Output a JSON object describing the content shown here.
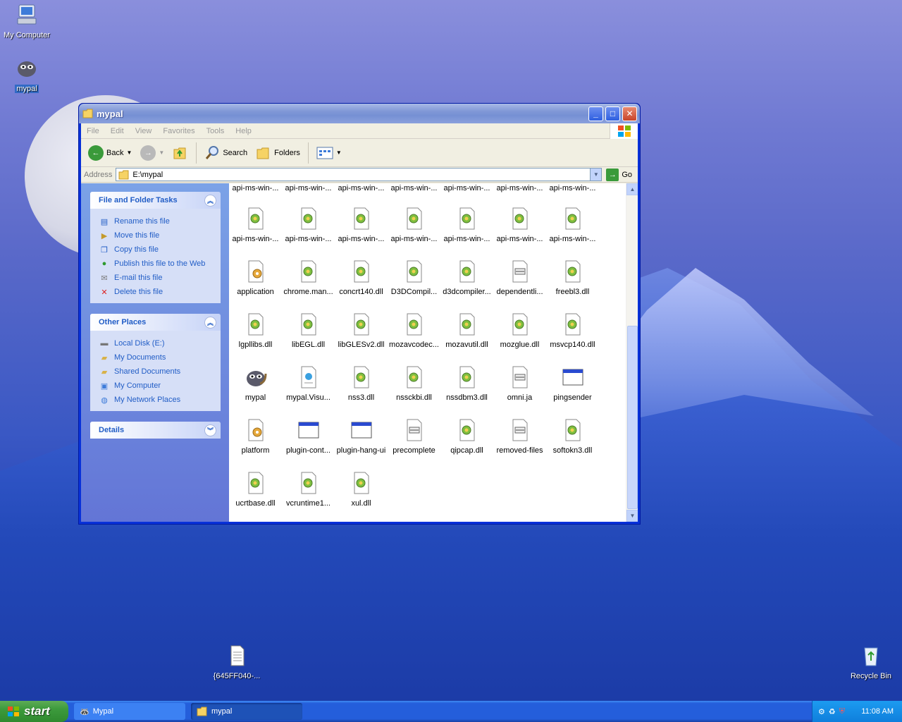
{
  "desktop": {
    "icons": [
      {
        "label": "My Computer"
      },
      {
        "label": "mypal"
      },
      {
        "label": "{645FF040-..."
      },
      {
        "label": "Recycle Bin"
      }
    ]
  },
  "window": {
    "title": "mypal",
    "controls": {
      "minimize": "_",
      "maximize": "□",
      "close": "✕"
    },
    "menu": [
      "File",
      "Edit",
      "View",
      "Favorites",
      "Tools",
      "Help"
    ],
    "toolbar": {
      "back": "Back",
      "search": "Search",
      "folders": "Folders"
    },
    "address": {
      "label": "Address",
      "value": "E:\\mypal",
      "go": "Go"
    },
    "task_pane": {
      "file_tasks": {
        "title": "File and Folder Tasks",
        "items": [
          {
            "label": "Rename this file",
            "icon": "rename-icon"
          },
          {
            "label": "Move this file",
            "icon": "move-icon"
          },
          {
            "label": "Copy this file",
            "icon": "copy-icon"
          },
          {
            "label": "Publish this file to the Web",
            "icon": "globe-icon"
          },
          {
            "label": "E-mail this file",
            "icon": "mail-icon"
          },
          {
            "label": "Delete this file",
            "icon": "delete-icon"
          }
        ]
      },
      "other_places": {
        "title": "Other Places",
        "items": [
          {
            "label": "Local Disk (E:)",
            "icon": "drive-icon"
          },
          {
            "label": "My Documents",
            "icon": "folder-icon"
          },
          {
            "label": "Shared Documents",
            "icon": "folder-icon"
          },
          {
            "label": "My Computer",
            "icon": "computer-icon"
          },
          {
            "label": "My Network Places",
            "icon": "network-icon"
          }
        ]
      },
      "details": {
        "title": "Details"
      }
    },
    "files": {
      "row0": [
        "api-ms-win-...",
        "api-ms-win-...",
        "api-ms-win-...",
        "api-ms-win-...",
        "api-ms-win-...",
        "api-ms-win-...",
        "api-ms-win-..."
      ],
      "row1": [
        "api-ms-win-...",
        "api-ms-win-...",
        "api-ms-win-...",
        "api-ms-win-...",
        "api-ms-win-...",
        "api-ms-win-...",
        "api-ms-win-..."
      ],
      "row2": [
        "application",
        "chrome.man...",
        "concrt140.dll",
        "D3DCompil...",
        "d3dcompiler...",
        "dependentli...",
        "freebl3.dll"
      ],
      "row3": [
        "lgpllibs.dll",
        "libEGL.dll",
        "libGLESv2.dll",
        "mozavcodec...",
        "mozavutil.dll",
        "mozglue.dll",
        "msvcp140.dll"
      ],
      "row4": [
        "mypal",
        "mypal.Visu...",
        "nss3.dll",
        "nssckbi.dll",
        "nssdbm3.dll",
        "omni.ja",
        "pingsender"
      ],
      "row5": [
        "platform",
        "plugin-cont...",
        "plugin-hang-ui",
        "precomplete",
        "qipcap.dll",
        "removed-files",
        "softokn3.dll"
      ],
      "row6": [
        "ucrtbase.dll",
        "vcruntime1...",
        "xul.dll"
      ]
    }
  },
  "taskbar": {
    "start": "start",
    "tasks": [
      {
        "label": "Mypal"
      },
      {
        "label": "mypal"
      }
    ],
    "clock": "11:08 AM"
  }
}
